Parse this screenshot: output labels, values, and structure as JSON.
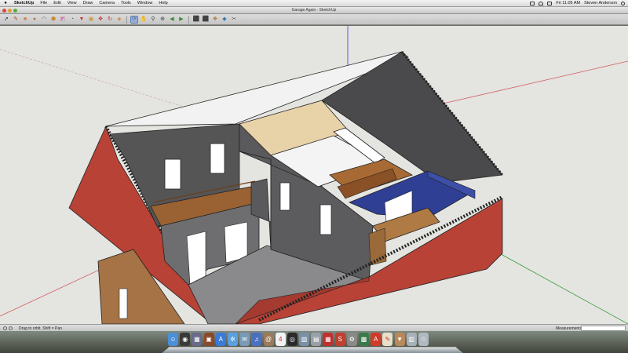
{
  "menubar": {
    "app_name": "SketchUp",
    "items": [
      "File",
      "Edit",
      "View",
      "Draw",
      "Camera",
      "Tools",
      "Window",
      "Help"
    ],
    "clock": "Fri 11:05 AM",
    "user": "Steven Anderson"
  },
  "window": {
    "title": "Garage Again - SketchUp"
  },
  "toolbar": {
    "tools": [
      {
        "name": "select-tool",
        "glyph": "➚",
        "color": "#222222"
      },
      {
        "name": "line-tool",
        "glyph": "✎",
        "color": "#b33a2a"
      },
      {
        "name": "rectangle-tool",
        "glyph": "■",
        "color": "#c7864a"
      },
      {
        "name": "circle-tool",
        "glyph": "●",
        "color": "#b87a4a"
      },
      {
        "name": "arc-tool",
        "glyph": "◠",
        "color": "#555555"
      },
      {
        "name": "make-component-tool",
        "glyph": "⬢",
        "color": "#c98a30"
      },
      {
        "name": "eraser-tool",
        "glyph": "◩",
        "color": "#d07ab0"
      },
      {
        "name": "tape-measure-tool",
        "glyph": "◔",
        "color": "#6a6a6a"
      },
      {
        "name": "paint-bucket-tool",
        "glyph": "▼",
        "color": "#c03a3a"
      },
      {
        "name": "push-pull-tool",
        "glyph": "▣",
        "color": "#c99a3a"
      },
      {
        "name": "move-tool",
        "glyph": "✥",
        "color": "#c03030"
      },
      {
        "name": "rotate-tool",
        "glyph": "↻",
        "color": "#c03030"
      },
      {
        "name": "offset-tool",
        "glyph": "◈",
        "color": "#cc8a30"
      },
      {
        "name": "orbit-tool",
        "glyph": "⟳",
        "color": "#4a6a9a"
      },
      {
        "name": "pan-tool",
        "glyph": "✋",
        "color": "#c08a60"
      },
      {
        "name": "zoom-tool",
        "glyph": "⚲",
        "color": "#444444"
      },
      {
        "name": "zoom-extents-tool",
        "glyph": "⊕",
        "color": "#444444"
      },
      {
        "name": "previous-view-tool",
        "glyph": "◀",
        "color": "#3a8a3a"
      },
      {
        "name": "next-view-tool",
        "glyph": "▶",
        "color": "#3a8a3a"
      },
      {
        "name": "get-models-tool",
        "glyph": "⬛",
        "color": "#8a6a3a"
      },
      {
        "name": "share-model-tool",
        "glyph": "⬛",
        "color": "#6a8a3a"
      },
      {
        "name": "components-tool",
        "glyph": "❖",
        "color": "#b0702a"
      },
      {
        "name": "extension-tool",
        "glyph": "◆",
        "color": "#3a7ab0"
      },
      {
        "name": "layout-tool",
        "glyph": "✂",
        "color": "#5a5a5a"
      }
    ]
  },
  "statusbar": {
    "hint": "Drag to orbit.  Shift = Pan",
    "measurements_label": "Measurements"
  },
  "dock": {
    "apps": [
      {
        "name": "finder-icon",
        "color": "#4a8fd8",
        "glyph": "☺"
      },
      {
        "name": "dashboard-icon",
        "color": "#3a3a3a",
        "glyph": "◉"
      },
      {
        "name": "mission-control-icon",
        "color": "#6a6a8a",
        "glyph": "▦"
      },
      {
        "name": "photo-app-icon",
        "color": "#8a4a2a",
        "glyph": "▣"
      },
      {
        "name": "app-store-icon",
        "color": "#3a7ad8",
        "glyph": "A"
      },
      {
        "name": "safari-icon",
        "color": "#5aa0e0",
        "glyph": "✲"
      },
      {
        "name": "mail-icon",
        "color": "#7a9ab8",
        "glyph": "✉"
      },
      {
        "name": "itunes-icon",
        "color": "#4a70c0",
        "glyph": "♫"
      },
      {
        "name": "contacts-icon",
        "color": "#9a7a5a",
        "glyph": "@"
      },
      {
        "name": "calendar-icon",
        "color": "#f2f2f2",
        "glyph": "4"
      },
      {
        "name": "photo-booth-icon",
        "color": "#2a2a2a",
        "glyph": "◎"
      },
      {
        "name": "iphoto-icon",
        "color": "#7a90a8",
        "glyph": "▨"
      },
      {
        "name": "preview-icon",
        "color": "#9aa0a8",
        "glyph": "▤"
      },
      {
        "name": "pdf-app-icon",
        "color": "#c03030",
        "glyph": "▦"
      },
      {
        "name": "sketchup-icon",
        "color": "#c04030",
        "glyph": "S"
      },
      {
        "name": "system-preferences-icon",
        "color": "#8a8a8a",
        "glyph": "⚙"
      },
      {
        "name": "image-capture-icon",
        "color": "#3a7a4a",
        "glyph": "▩"
      },
      {
        "name": "acrobat-icon",
        "color": "#d03a2a",
        "glyph": "A"
      },
      {
        "name": "textedit-icon",
        "color": "#e8e0c8",
        "glyph": "✎"
      },
      {
        "name": "downloads-stack-icon",
        "color": "#b88a5a",
        "glyph": "▼"
      },
      {
        "name": "documents-stack-icon",
        "color": "#a8b0b8",
        "glyph": "▥"
      },
      {
        "name": "trash-icon",
        "color": "#b0b8c0",
        "glyph": "♲"
      }
    ]
  }
}
